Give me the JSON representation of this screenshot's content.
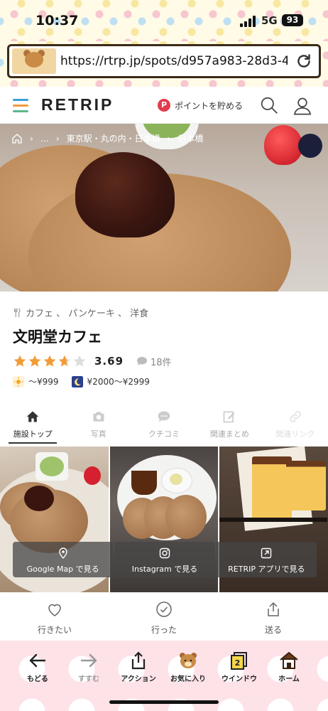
{
  "status": {
    "time": "10:37",
    "network": "5G",
    "battery": "93"
  },
  "browser": {
    "url": "https://rtrp.jp/spots/d957a983-28d3-4..."
  },
  "site": {
    "logo": "RETRIP",
    "points_label": "ポイントを貯める",
    "points_badge": "P"
  },
  "breadcrumb": {
    "ellipsis": "…",
    "area": "東京駅・丸の内・日本橋",
    "sub": "日本橋"
  },
  "spot": {
    "genres": "カフェ 、 パンケーキ 、 洋食",
    "name": "文明堂カフェ",
    "rating": 3.69,
    "rating_text": "3.69",
    "review_count": "18件",
    "price_lunch": "〜¥999",
    "price_dinner": "¥2000〜¥2999",
    "price_colors": {
      "lunch": "#f5a623",
      "dinner": "#2b3f8f"
    }
  },
  "tabs": [
    {
      "label": "施設トップ",
      "icon": "home-icon"
    },
    {
      "label": "写真",
      "icon": "camera-icon"
    },
    {
      "label": "クチコミ",
      "icon": "comment-icon"
    },
    {
      "label": "関連まとめ",
      "icon": "edit-icon"
    },
    {
      "label": "関連リンク",
      "icon": "link-icon"
    }
  ],
  "external": [
    {
      "label": "Google Map で見る",
      "icon": "map-pin-icon"
    },
    {
      "label": "Instagram で見る",
      "icon": "instagram-icon"
    },
    {
      "label": "RETRIP アプリで見る",
      "icon": "external-link-icon"
    }
  ],
  "actions": [
    {
      "label": "行きたい",
      "icon": "heart-icon"
    },
    {
      "label": "行った",
      "icon": "check-circle-icon"
    },
    {
      "label": "送る",
      "icon": "share-icon"
    }
  ],
  "toolbar": [
    {
      "label": "もどる",
      "icon": "back-arrow-icon"
    },
    {
      "label": "すすむ",
      "icon": "forward-arrow-icon"
    },
    {
      "label": "アクション",
      "icon": "action-icon"
    },
    {
      "label": "お気に入り",
      "icon": "bear-icon"
    },
    {
      "label": "ウインドウ",
      "icon": "window-icon",
      "badge": "2"
    },
    {
      "label": "ホーム",
      "icon": "house-icon"
    }
  ],
  "colors": {
    "accent_star": "#f29c38",
    "points_red": "#e23b4e",
    "menu_blue": "#3aa0d8",
    "menu_orange": "#f19b3b",
    "menu_green": "#5bb98b"
  }
}
